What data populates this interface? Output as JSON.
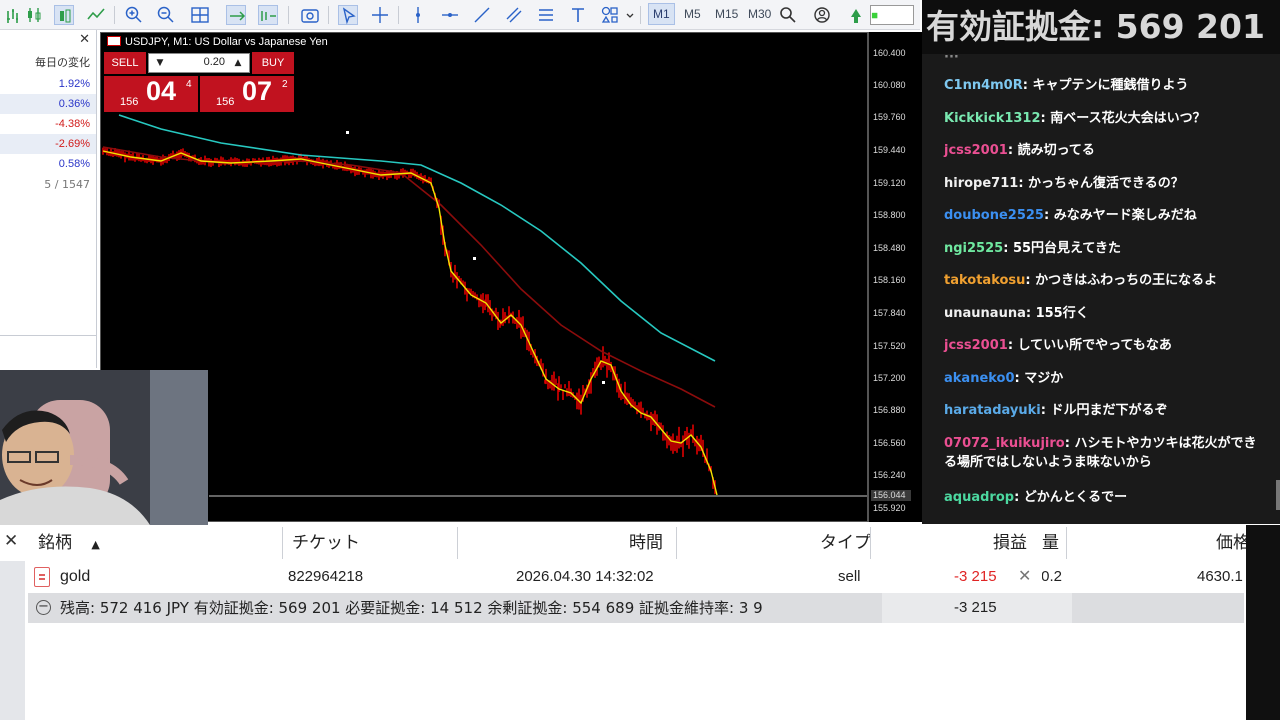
{
  "toolbar": {
    "timeframes": [
      "M1",
      "M5",
      "M15",
      "M30"
    ],
    "active_timeframe": "M1"
  },
  "market_watch": {
    "header": "毎日の変化",
    "rows": [
      {
        "value": "1.92%",
        "color": "#2a35c8",
        "highlight": false
      },
      {
        "value": "0.36%",
        "color": "#2a35c8",
        "highlight": true
      },
      {
        "value": "-4.38%",
        "color": "#d11b1b",
        "highlight": false
      },
      {
        "value": "-2.69%",
        "color": "#d11b1b",
        "highlight": true
      },
      {
        "value": "0.58%",
        "color": "#2a35c8",
        "highlight": false
      }
    ],
    "count": "5 / 1547"
  },
  "chart": {
    "title": "USDJPY, M1:  US Dollar vs Japanese Yen",
    "price_labels": [
      "160.400",
      "160.080",
      "159.760",
      "159.440",
      "159.120",
      "158.800",
      "158.480",
      "158.160",
      "157.840",
      "157.520",
      "157.200",
      "156.880",
      "156.560",
      "156.240",
      "155.920"
    ],
    "current_price": "156.044",
    "colors": {
      "background": "#000000",
      "candles": "#e00000",
      "ma_fast": "#f2e600",
      "ma_mid": "#8b0c0c",
      "ma_slow": "#27c8c0"
    }
  },
  "one_click": {
    "sell_label": "SELL",
    "buy_label": "BUY",
    "volume": "0.20",
    "sell_quote": {
      "prefix": "156",
      "big": "04",
      "sup": "4"
    },
    "buy_quote": {
      "prefix": "156",
      "big": "07",
      "sup": "2"
    }
  },
  "stream": {
    "header": "有効証拠金: 569 201",
    "messages": [
      {
        "user": "C1nn4m0R",
        "text": "キャプテンに種銭借りよう",
        "color": "#7ec8f0"
      },
      {
        "user": "Kickkick1312",
        "text": "南ベース花火大会はいつ？",
        "color": "#79e8b0"
      },
      {
        "user": "jcss2001",
        "text": "読み切ってる",
        "color": "#ea4f92"
      },
      {
        "user": "hirope711",
        "text": "かっちゃん復活できるの？",
        "color": "#f0f0f0"
      },
      {
        "user": "doubone2525",
        "text": "みなみヤード楽しみだね",
        "color": "#3b8ff0"
      },
      {
        "user": "ngi2525",
        "text": "55円台見えてきた",
        "color": "#6fe8a0"
      },
      {
        "user": "takotakosu",
        "text": "かつきはふわっちの王になるよ",
        "color": "#f0a030"
      },
      {
        "user": "unaunauna",
        "text": "155行く",
        "color": "#f0f0f0"
      },
      {
        "user": "jcss2001",
        "text": "していい所でやってもなあ",
        "color": "#ea4f92"
      },
      {
        "user": "akaneko0",
        "text": "マジか",
        "color": "#3b8ff0"
      },
      {
        "user": "haratadayuki",
        "text": "ドル円まだ下がるぞ",
        "color": "#5aaae8"
      },
      {
        "user": "07072_ikuikujiro",
        "text": "ハシモトやカツキは花火ができる場所ではしないようま味ないから",
        "color": "#ea4f92"
      },
      {
        "user": "aquadrop",
        "text": "どかんとくるでー",
        "color": "#4cd8a0"
      }
    ]
  },
  "terminal": {
    "columns": {
      "symbol": "銘柄",
      "ticket": "チケット",
      "time": "時間",
      "type": "タイプ",
      "profit": "損益",
      "volume": "量",
      "price": "価格"
    },
    "position": {
      "symbol": "gold",
      "ticket": "822964218",
      "time": "2026.04.30 14:32:02",
      "type": "sell",
      "profit": "-3 215",
      "volume": "0.2",
      "price": "4630.1"
    },
    "summary": "残高: 572 416 JPY  有効証拠金: 569 201  必要証拠金: 14 512  余剰証拠金: 554 689  証拠金維持率: 3 9",
    "summary_profit": "-3 215"
  }
}
